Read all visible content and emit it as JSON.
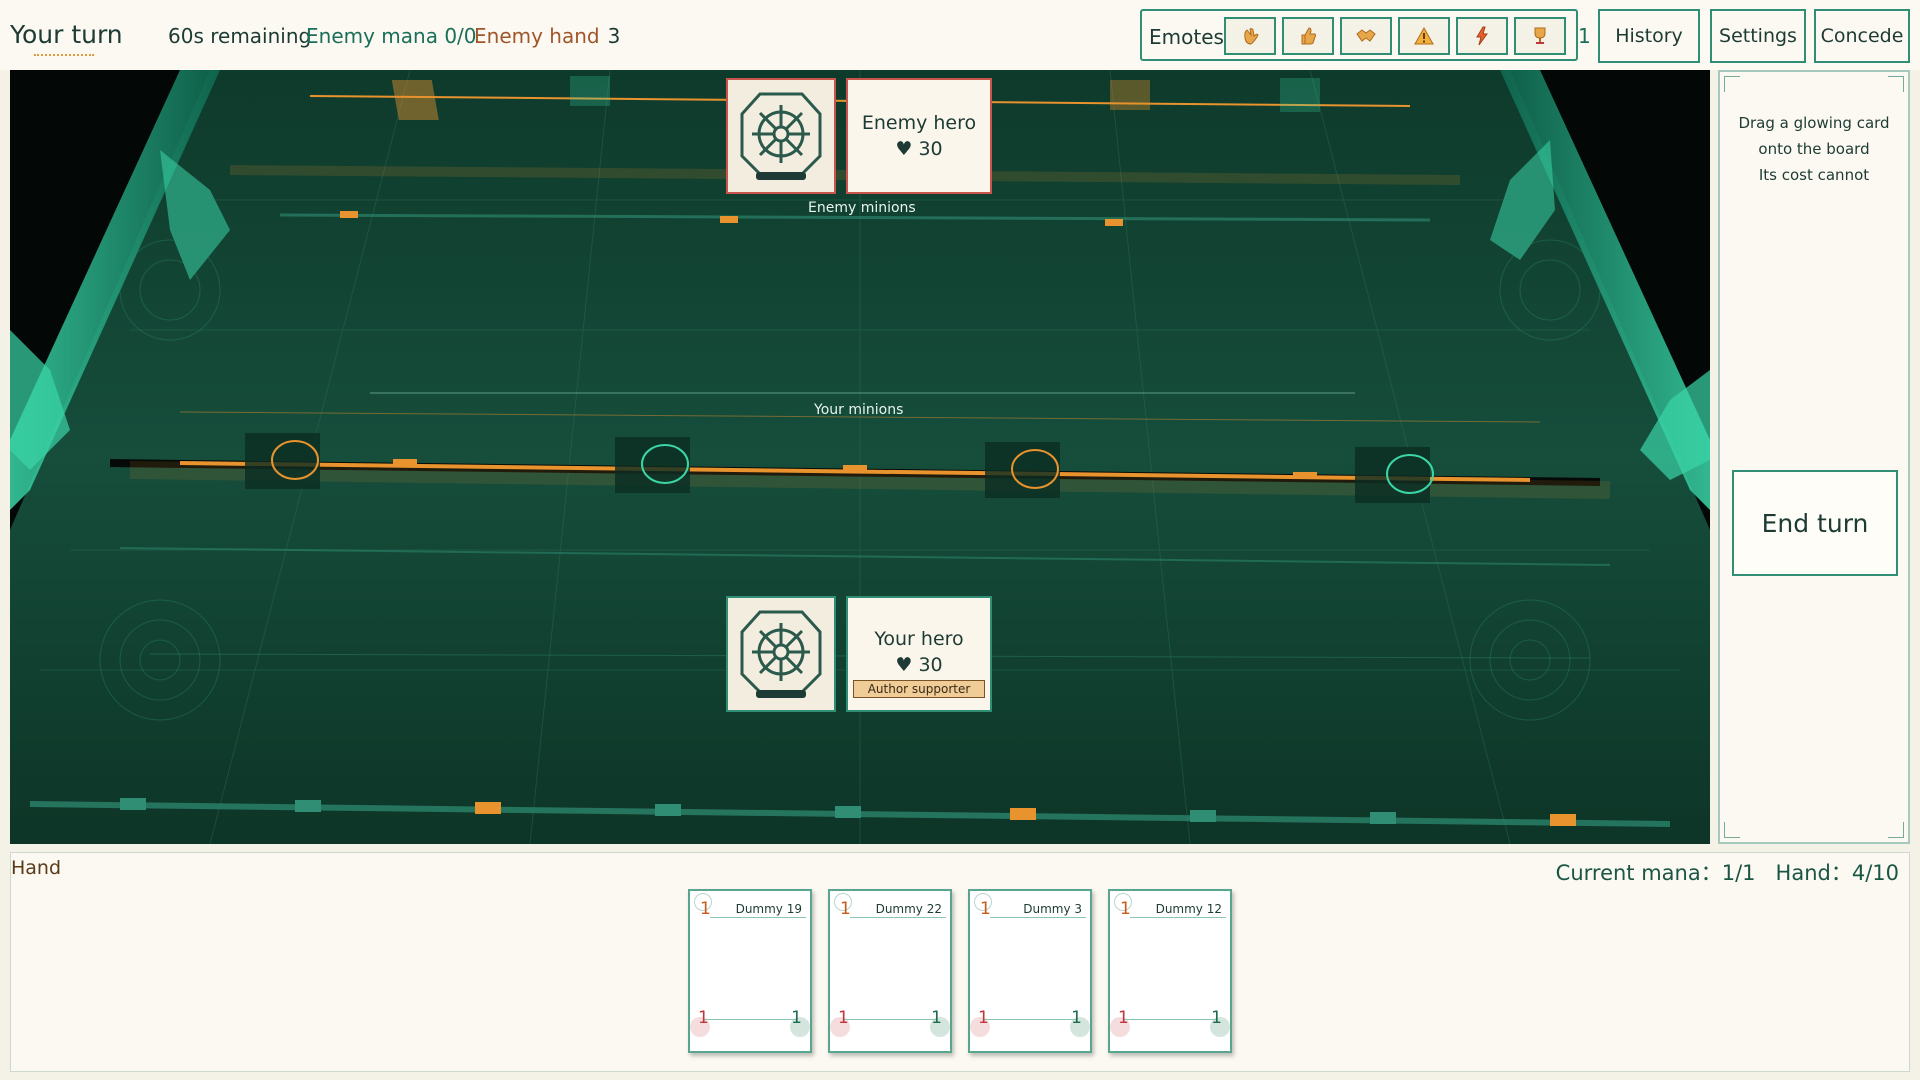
{
  "topbar": {
    "turn": "Your turn",
    "timer": "60s remaining",
    "enemy_mana": "Enemy mana 0/0",
    "enemy_hand_label": "Enemy hand",
    "enemy_hand_count": "3",
    "emotes_label": "Emotes",
    "emotes": [
      "wave-icon",
      "thumbs-up-icon",
      "handshake-icon",
      "warning-icon",
      "lightning-icon",
      "trophy-icon"
    ],
    "emote_count": "1",
    "history": "History",
    "settings": "Settings",
    "concede": "Concede"
  },
  "board": {
    "enemy_hero": {
      "name": "Enemy hero",
      "hp": "♥ 30"
    },
    "enemy_minions_label": "Enemy minions",
    "your_minions_label": "Your minions",
    "your_hero": {
      "name": "Your hero",
      "hp": "♥ 30",
      "badge": "Author supporter"
    }
  },
  "side_panel": {
    "hint_lines": [
      "Drag a glowing card",
      "onto the board",
      "Its cost cannot"
    ],
    "end_turn": "End turn"
  },
  "hand": {
    "title": "Hand",
    "stats": "Current mana：1/1   Hand：4/10",
    "cards": [
      {
        "name": "Dummy 19",
        "cost": "1",
        "attack": "1",
        "health": "1"
      },
      {
        "name": "Dummy 22",
        "cost": "1",
        "attack": "1",
        "health": "1"
      },
      {
        "name": "Dummy 3",
        "cost": "1",
        "attack": "1",
        "health": "1"
      },
      {
        "name": "Dummy 12",
        "cost": "1",
        "attack": "1",
        "health": "1"
      }
    ]
  },
  "colors": {
    "accent": "#2f8e74",
    "enemy": "#c9544e",
    "board": "#0f3b2c",
    "highlight": "#e8932e"
  }
}
